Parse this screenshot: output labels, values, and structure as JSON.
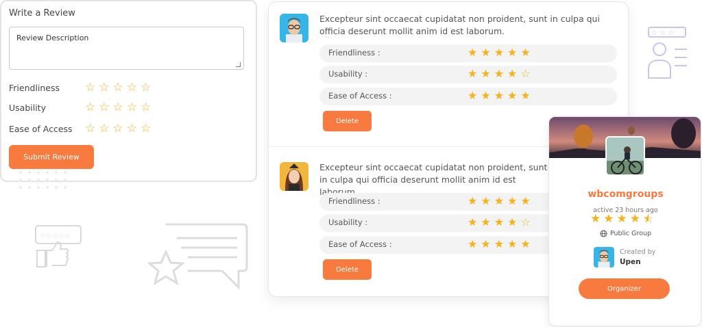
{
  "review_form": {
    "title": "Write a Review",
    "description_placeholder": "Review Description",
    "criteria": [
      "Friendliness",
      "Usability",
      "Ease of Access"
    ],
    "submit_label": "Submit Review"
  },
  "reviews": [
    {
      "text": "Excepteur sint occaecat cupidatat non proident, sunt in culpa qui officia deserunt mollit anim id est laborum.",
      "ratings": [
        {
          "label": "Friendliness :",
          "stars": 5
        },
        {
          "label": "Usability :",
          "stars": 4
        },
        {
          "label": "Ease of Access :",
          "stars": 5
        }
      ],
      "delete_label": "Delete"
    },
    {
      "text": "Excepteur sint occaecat cupidatat non proident, sunt in culpa qui officia deserunt mollit anim id est laborum.",
      "ratings": [
        {
          "label": "Friendliness :",
          "stars": 5
        },
        {
          "label": "Usability :",
          "stars": 4
        },
        {
          "label": "Ease of Access :",
          "stars": 5
        }
      ],
      "delete_label": "Delete"
    }
  ],
  "group": {
    "name": "wbcomgroups",
    "active": "active 23 hours ago",
    "rating": 4.5,
    "type": "Public Group",
    "created_by_label": "Created by",
    "creator": "Upen",
    "organizer_label": "Organizer"
  },
  "colors": {
    "accent": "#f97a3f",
    "star": "#f7b21b",
    "row_bg": "#f3f3f3"
  }
}
